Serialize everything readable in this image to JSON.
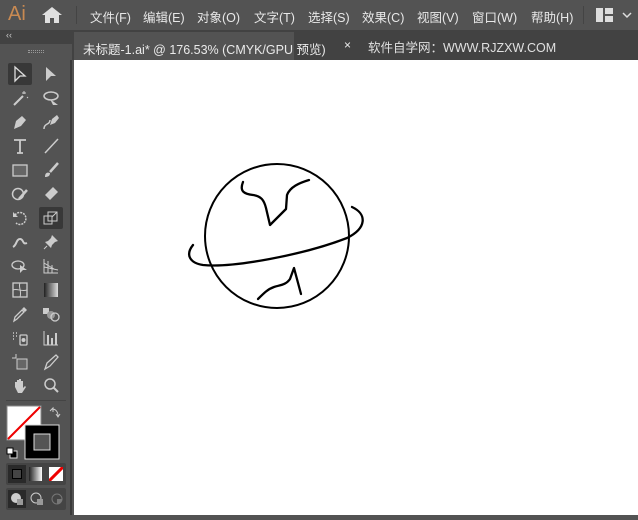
{
  "app": {
    "logo": "Ai"
  },
  "menu": [
    "文件(F)",
    "编辑(E)",
    "对象(O)",
    "文字(T)",
    "选择(S)",
    "效果(C)",
    "视图(V)",
    "窗口(W)",
    "帮助(H)"
  ],
  "document_tab": {
    "title": "未标题-1.ai* @ 176.53% (CMYK/GPU 预览)",
    "close": "×"
  },
  "watermark": "软件自学网：WWW.RJZXW.COM",
  "toolbar": {
    "collapse": "‹‹",
    "tools": [
      "selection",
      "direct-selection",
      "magic-wand",
      "lasso",
      "pen",
      "curvature",
      "type",
      "line-segment",
      "rectangle",
      "paintbrush",
      "shaper",
      "eraser",
      "rotate",
      "scale",
      "puppet-warp",
      "pin",
      "shape-builder",
      "perspective-grid",
      "mesh",
      "gradient",
      "eyedropper",
      "blend",
      "symbol-sprayer",
      "column-graph",
      "artboard",
      "slice",
      "hand",
      "zoom"
    ],
    "selected": [
      "selection",
      "scale"
    ]
  },
  "colors": {
    "fill": "none",
    "stroke": "#000000",
    "accent": "#c98a52"
  }
}
